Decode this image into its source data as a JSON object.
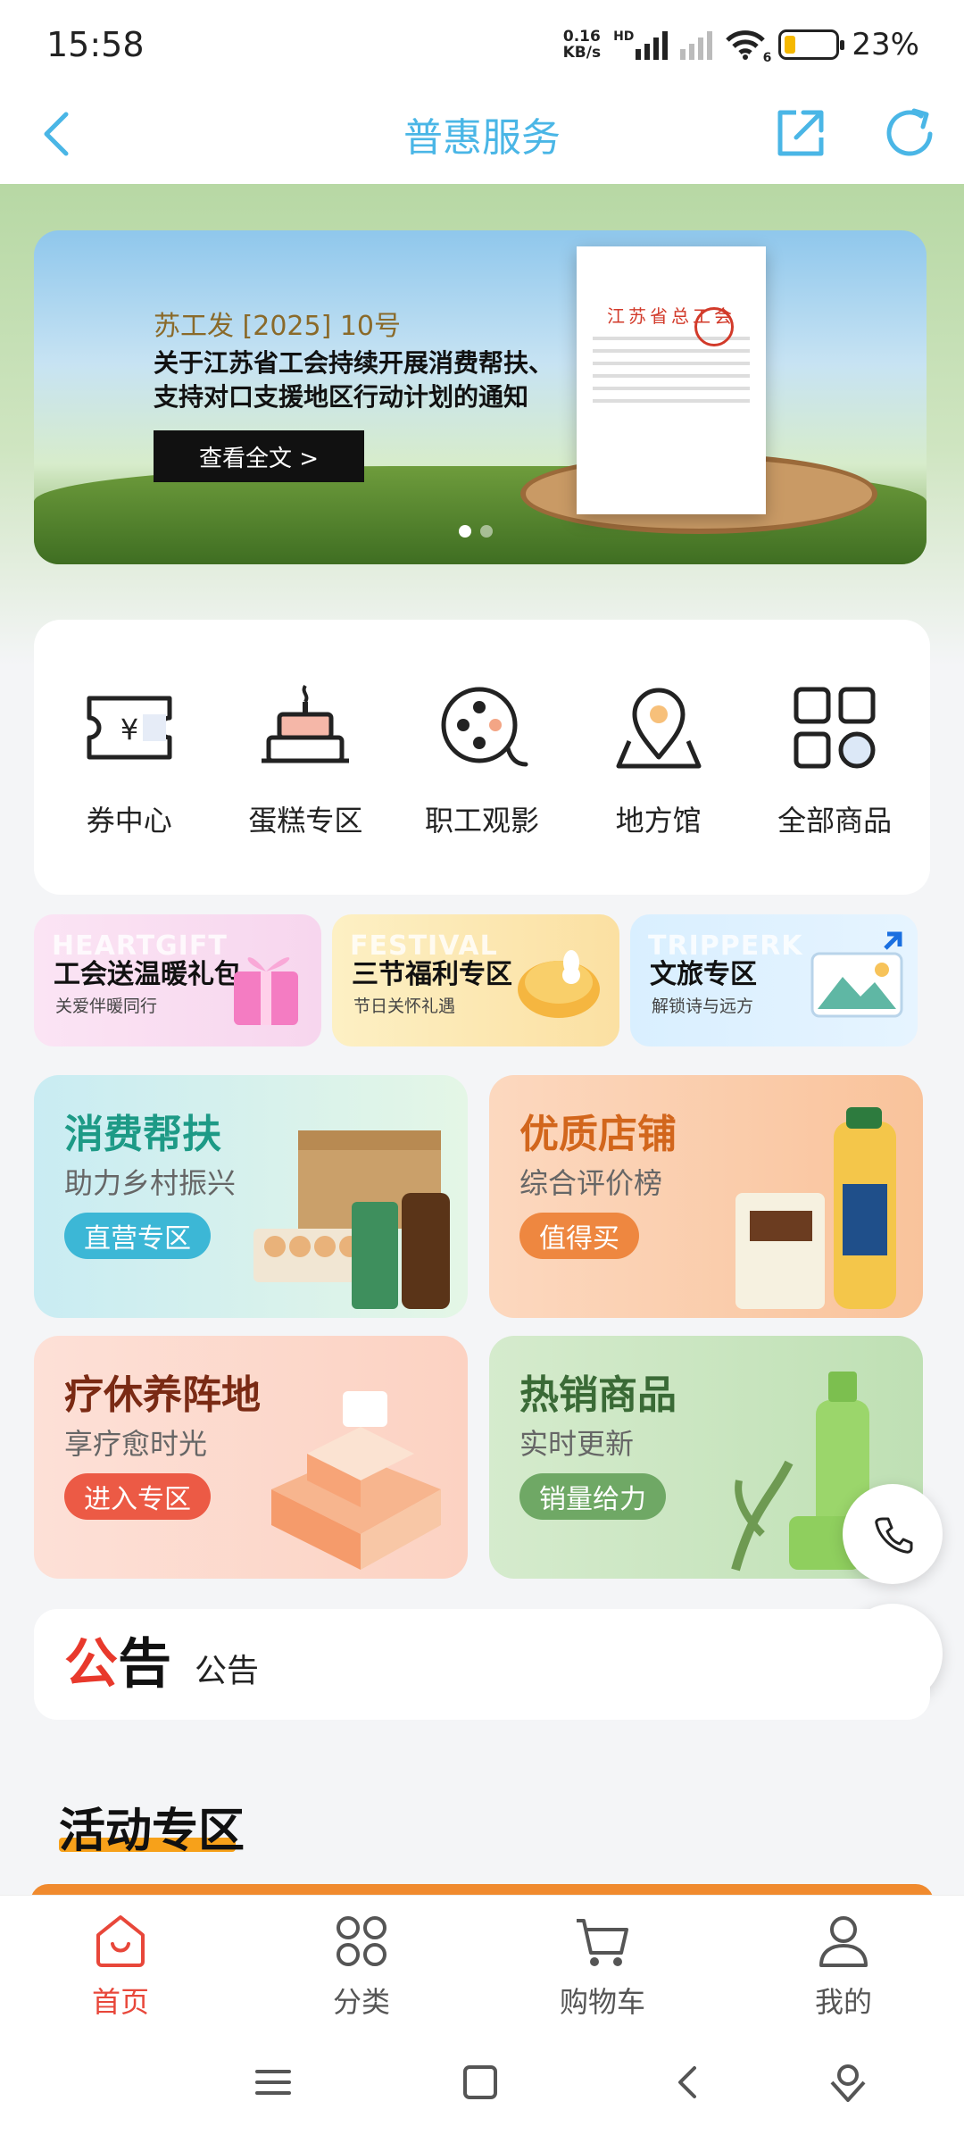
{
  "status_bar": {
    "time": "15:58",
    "net_speed_value": "0.16",
    "net_speed_unit": "KB/s",
    "network_label": "HD",
    "wifi_label": "6",
    "battery_percent": "23%",
    "battery_level": 0.23
  },
  "nav": {
    "title": "普惠服务",
    "back_icon": "chevron-left-icon",
    "share_icon": "external-link-icon",
    "refresh_icon": "refresh-icon",
    "accent_color": "#4ab6e6"
  },
  "banner": {
    "doc_ref": "苏工发 [2025] 10号",
    "heading_line1": "关于江苏省工会持续开展消费帮扶、",
    "heading_line2": "支持对口支援地区行动计划的通知",
    "button_label": "查看全文 >",
    "doc_header": "江苏省总工会",
    "slide_count": 2,
    "active_slide": 0
  },
  "categories": [
    {
      "label": "券中心",
      "icon": "coupon-icon"
    },
    {
      "label": "蛋糕专区",
      "icon": "cake-icon"
    },
    {
      "label": "职工观影",
      "icon": "film-reel-icon"
    },
    {
      "label": "地方馆",
      "icon": "map-pin-icon"
    },
    {
      "label": "全部商品",
      "icon": "grid-icon"
    }
  ],
  "promos": [
    {
      "ghost": "HEARTGIFT",
      "title": "工会送温暖礼包",
      "subtitle": "关爱伴暖同行"
    },
    {
      "ghost": "FESTIVAL",
      "title": "三节福利专区",
      "subtitle": "节日关怀礼遇"
    },
    {
      "ghost": "TRIPPERK",
      "title": "文旅专区",
      "subtitle": "解锁诗与远方"
    }
  ],
  "tiles": [
    {
      "title": "消费帮扶",
      "subtitle": "助力乡村振兴",
      "button": "直营专区"
    },
    {
      "title": "优质店铺",
      "subtitle": "综合评价榜",
      "button": "值得买"
    },
    {
      "title": "疗休养阵地",
      "subtitle": "享疗愈时光",
      "button": "进入专区"
    },
    {
      "title": "热销商品",
      "subtitle": "实时更新",
      "button": "销量给力"
    }
  ],
  "fabs": {
    "phone_icon": "phone-icon",
    "service_icon": "headset-icon"
  },
  "notice": {
    "logo_char1": "公",
    "logo_char2": "告",
    "text": "公告"
  },
  "activity": {
    "title": "活动专区"
  },
  "tabbar": [
    {
      "label": "首页",
      "icon": "home-bag-icon",
      "active": true
    },
    {
      "label": "分类",
      "icon": "category-icon",
      "active": false
    },
    {
      "label": "购物车",
      "icon": "cart-icon",
      "active": false
    },
    {
      "label": "我的",
      "icon": "user-icon",
      "active": false
    }
  ],
  "system_nav": [
    "menu-icon",
    "home-square-icon",
    "back-icon",
    "assistant-icon"
  ]
}
